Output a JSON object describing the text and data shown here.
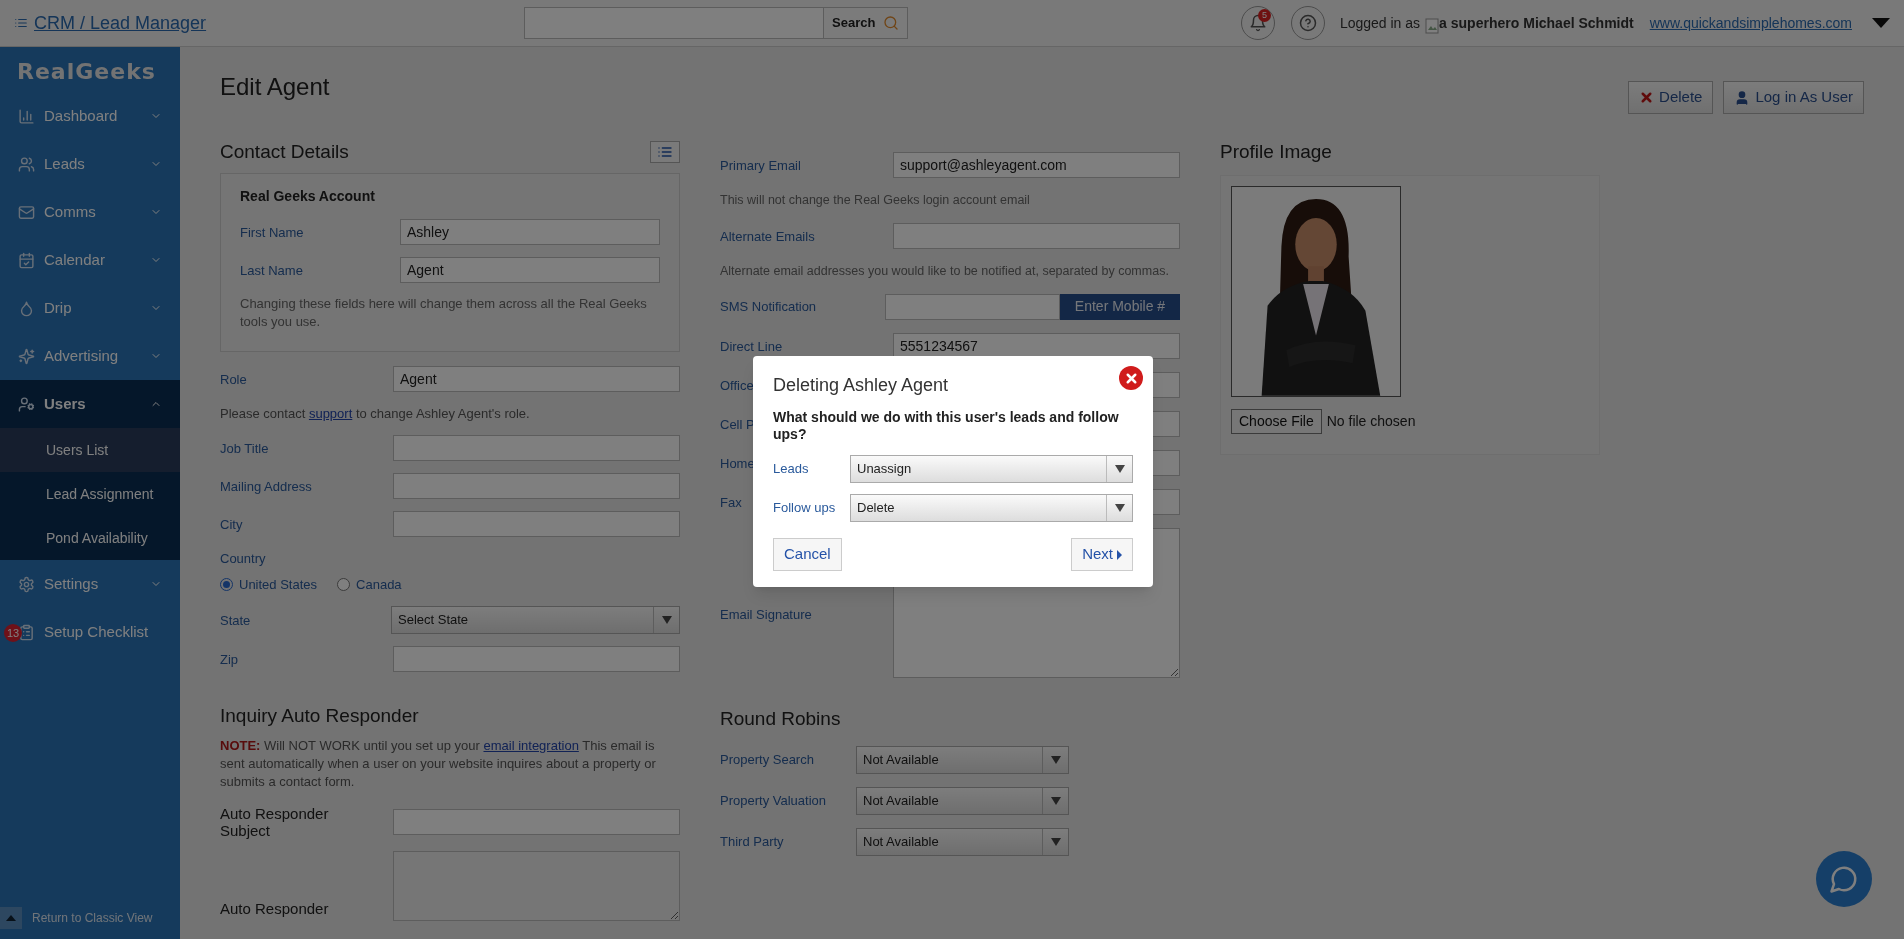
{
  "topbar": {
    "title": "CRM / Lead Manager",
    "search_button": "Search",
    "notifications": "5",
    "logged_in_label": "Logged in as",
    "avatar_alt": "a superhero",
    "user_name": "Michael Schmidt",
    "site_link": "www.quickandsimplehomes.com"
  },
  "sidebar": {
    "logo": "RealGeeks",
    "items": [
      {
        "kind": "dashboard",
        "label": "Dashboard",
        "expanded": false
      },
      {
        "kind": "leads",
        "label": "Leads",
        "expanded": false
      },
      {
        "kind": "comms",
        "label": "Comms",
        "expanded": false
      },
      {
        "kind": "calendar",
        "label": "Calendar",
        "expanded": false
      },
      {
        "kind": "drip",
        "label": "Drip",
        "expanded": false
      },
      {
        "kind": "advertising",
        "label": "Advertising",
        "expanded": false
      },
      {
        "kind": "users",
        "label": "Users",
        "expanded": true,
        "children": [
          {
            "label": "Users List",
            "selected": true
          },
          {
            "label": "Lead Assignment",
            "selected": false
          },
          {
            "label": "Pond Availability",
            "selected": false
          }
        ]
      },
      {
        "kind": "settings",
        "label": "Settings",
        "expanded": false
      },
      {
        "kind": "checklist",
        "label": "Setup Checklist",
        "badge": "13"
      }
    ],
    "footer": "Return to Classic View"
  },
  "page": {
    "title": "Edit Agent",
    "actions": [
      {
        "kind": "delete",
        "label": "Delete"
      },
      {
        "kind": "login",
        "label": "Log in As User"
      }
    ]
  },
  "contact": {
    "title": "Contact Details",
    "account": {
      "title": "Real Geeks Account",
      "fields": [
        {
          "label": "First Name",
          "value": "Ashley"
        },
        {
          "label": "Last Name",
          "value": "Agent"
        }
      ],
      "note": "Changing these fields here will change them across all the Real Geeks tools you use."
    },
    "role": {
      "label": "Role",
      "value": "Agent"
    },
    "role_note": {
      "before": "Please contact",
      "link": "support",
      "after": "to change Ashley Agent's role."
    },
    "fields": [
      {
        "label": "Job Title"
      },
      {
        "label": "Mailing Address"
      },
      {
        "label": "City"
      }
    ],
    "country": {
      "label": "Country",
      "options": [
        {
          "label": "United States",
          "selected": true
        },
        {
          "label": "Canada",
          "selected": false
        }
      ]
    },
    "state": {
      "label": "State",
      "value": "Select State"
    },
    "zip": {
      "label": "Zip"
    }
  },
  "responder": {
    "title": "Inquiry Auto Responder",
    "note_label": "NOTE:",
    "note_before": "Will NOT WORK until you set up your",
    "note_link": "email integration",
    "note_after": "This email is sent automatically when a user on your website inquires about a property or submits a contact form.",
    "subject_label": "Auto Responder Subject",
    "body_label": "Auto Responder"
  },
  "contact_info": {
    "primary_email": {
      "label": "Primary Email",
      "value": "support@ashleyagent.com",
      "note": "This will not change the Real Geeks login account email"
    },
    "alternate_emails": {
      "label": "Alternate Emails",
      "note": "Alternate email addresses you would like to be notified at, separated by commas."
    },
    "sms": {
      "label": "SMS Notification",
      "button": "Enter Mobile #"
    },
    "phones": [
      {
        "label": "Direct Line",
        "value": "5551234567"
      },
      {
        "label": "Office"
      },
      {
        "label": "Cell P"
      },
      {
        "label": "Home"
      },
      {
        "label": "Fax"
      }
    ],
    "signature": {
      "label": "Email Signature"
    }
  },
  "round_robins": {
    "title": "Round Robins",
    "rows": [
      {
        "label": "Property Search",
        "value": "Not Available"
      },
      {
        "label": "Property Valuation",
        "value": "Not Available"
      },
      {
        "label": "Third Party",
        "value": "Not Available"
      }
    ]
  },
  "profile": {
    "title": "Profile Image",
    "file_button": "Choose File",
    "file_status": "No file chosen"
  },
  "dialog": {
    "title": "Deleting Ashley Agent",
    "question": "What should we do with this user's leads and follow ups?",
    "selects": [
      {
        "label": "Leads",
        "value": "Unassign"
      },
      {
        "label": "Follow ups",
        "value": "Delete"
      }
    ],
    "cancel": "Cancel",
    "next": "Next"
  }
}
